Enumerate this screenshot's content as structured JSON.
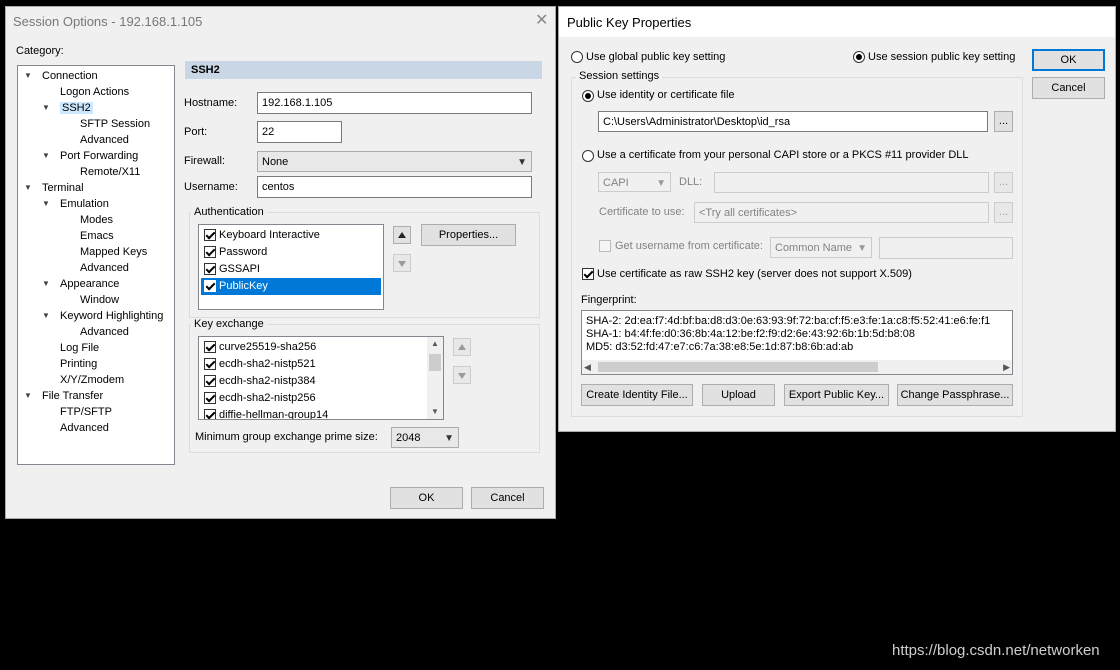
{
  "session_dialog": {
    "title": "Session Options - 192.168.1.105",
    "category_label": "Category:",
    "tree": [
      {
        "label": "Connection",
        "level": 0,
        "expanded": true
      },
      {
        "label": "Logon Actions",
        "level": 1
      },
      {
        "label": "SSH2",
        "level": 1,
        "expanded": true,
        "selected": true
      },
      {
        "label": "SFTP Session",
        "level": 2
      },
      {
        "label": "Advanced",
        "level": 2
      },
      {
        "label": "Port Forwarding",
        "level": 1,
        "expanded": true
      },
      {
        "label": "Remote/X11",
        "level": 2
      },
      {
        "label": "Terminal",
        "level": 0,
        "expanded": true
      },
      {
        "label": "Emulation",
        "level": 1,
        "expanded": true
      },
      {
        "label": "Modes",
        "level": 2
      },
      {
        "label": "Emacs",
        "level": 2
      },
      {
        "label": "Mapped Keys",
        "level": 2
      },
      {
        "label": "Advanced",
        "level": 2
      },
      {
        "label": "Appearance",
        "level": 1,
        "expanded": true
      },
      {
        "label": "Window",
        "level": 2
      },
      {
        "label": "Keyword Highlighting",
        "level": 1,
        "expanded": true
      },
      {
        "label": "Advanced",
        "level": 2
      },
      {
        "label": "Log File",
        "level": 1
      },
      {
        "label": "Printing",
        "level": 1
      },
      {
        "label": "X/Y/Zmodem",
        "level": 1
      },
      {
        "label": "File Transfer",
        "level": 0,
        "expanded": true
      },
      {
        "label": "FTP/SFTP",
        "level": 1
      },
      {
        "label": "Advanced",
        "level": 1
      }
    ],
    "section_title": "SSH2",
    "hostname_label": "Hostname:",
    "hostname_value": "192.168.1.105",
    "port_label": "Port:",
    "port_value": "22",
    "firewall_label": "Firewall:",
    "firewall_value": "None",
    "username_label": "Username:",
    "username_value": "centos",
    "auth_group_label": "Authentication",
    "auth_methods": [
      {
        "label": "Keyboard Interactive",
        "checked": true
      },
      {
        "label": "Password",
        "checked": true
      },
      {
        "label": "GSSAPI",
        "checked": true
      },
      {
        "label": "PublicKey",
        "checked": true,
        "selected": true
      }
    ],
    "properties_button": "Properties...",
    "kex_group_label": "Key exchange",
    "kex_methods": [
      {
        "label": "curve25519-sha256",
        "checked": true
      },
      {
        "label": "ecdh-sha2-nistp521",
        "checked": true
      },
      {
        "label": "ecdh-sha2-nistp384",
        "checked": true
      },
      {
        "label": "ecdh-sha2-nistp256",
        "checked": true
      },
      {
        "label": "diffie-hellman-group14",
        "checked": true
      }
    ],
    "min_group_label": "Minimum group exchange prime size:",
    "min_group_value": "2048",
    "ok_button": "OK",
    "cancel_button": "Cancel"
  },
  "pubkey_dialog": {
    "title": "Public Key Properties",
    "radio_global": "Use global public key setting",
    "radio_session": "Use session public key setting",
    "ok_button": "OK",
    "cancel_button": "Cancel",
    "session_settings_label": "Session settings",
    "radio_identity": "Use identity or certificate file",
    "identity_path": "C:\\Users\\Administrator\\Desktop\\id_rsa",
    "browse_label": "...",
    "radio_capi": "Use a certificate from your personal CAPI store or a PKCS #11 provider DLL",
    "capi_value": "CAPI",
    "dll_label": "DLL:",
    "cert_to_use_label": "Certificate to use:",
    "cert_to_use_value": "<Try all certificates>",
    "get_username_label": "Get username from certificate:",
    "common_name_value": "Common Name",
    "raw_ssh2_label": "Use certificate as raw SSH2 key (server does not support X.509)",
    "fingerprint_label": "Fingerprint:",
    "fingerprint_lines": [
      "SHA-2: 2d:ea:f7:4d:bf:ba:d8:d3:0e:63:93:9f:72:ba:cf:f5:e3:fe:1a:c8:f5:52:41:e6:fe:f1",
      "SHA-1: b4:4f:fe:d0:36:8b:4a:12:be:f2:f9:d2:6e:43:92:6b:1b:5d:b8:08",
      "MD5: d3:52:fd:47:e7:c6:7a:38:e8:5e:1d:87:b8:6b:ad:ab"
    ],
    "create_identity_button": "Create Identity File...",
    "upload_button": "Upload",
    "export_button": "Export Public Key...",
    "change_pass_button": "Change Passphrase..."
  },
  "watermark": "https://blog.csdn.net/networken"
}
